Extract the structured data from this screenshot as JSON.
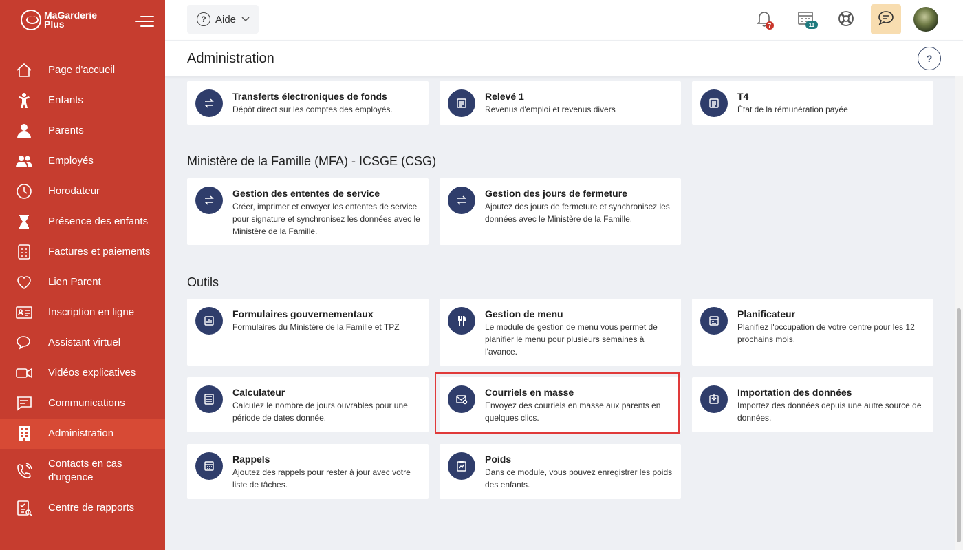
{
  "app": {
    "brand_line1": "MaGarderie",
    "brand_line2": "Plus"
  },
  "sidebar": {
    "items": [
      {
        "label": "Page d'accueil",
        "icon": "home-icon"
      },
      {
        "label": "Enfants",
        "icon": "child-icon"
      },
      {
        "label": "Parents",
        "icon": "parent-icon"
      },
      {
        "label": "Employés",
        "icon": "employees-icon"
      },
      {
        "label": "Horodateur",
        "icon": "clock-icon"
      },
      {
        "label": "Présence des enfants",
        "icon": "hourglass-icon"
      },
      {
        "label": "Factures et paiements",
        "icon": "invoice-icon"
      },
      {
        "label": "Lien Parent",
        "icon": "heart-icon"
      },
      {
        "label": "Inscription en ligne",
        "icon": "id-card-icon"
      },
      {
        "label": "Assistant virtuel",
        "icon": "chat-bubbles-icon"
      },
      {
        "label": "Vidéos explicatives",
        "icon": "video-icon"
      },
      {
        "label": "Communications",
        "icon": "message-icon"
      },
      {
        "label": "Administration",
        "icon": "building-icon",
        "active": true
      },
      {
        "label": "Contacts en cas d'urgence",
        "icon": "phone-icon"
      },
      {
        "label": "Centre de rapports",
        "icon": "report-icon"
      }
    ]
  },
  "topbar": {
    "help_label": "Aide",
    "notification_count": "7",
    "calendar_count": "11"
  },
  "header": {
    "title": "Administration"
  },
  "sections": {
    "payroll": {
      "cards": [
        {
          "title": "Transferts électroniques de fonds",
          "desc": "Dépôt direct sur les comptes des employés.",
          "icon": "transfer-icon"
        },
        {
          "title": "Relevé 1",
          "desc": "Revenus d'emploi et revenus divers",
          "icon": "document-icon"
        },
        {
          "title": "T4",
          "desc": "État de la rémunération payée",
          "icon": "document-icon"
        }
      ]
    },
    "ministry": {
      "title": "Ministère de la Famille (MFA) - ICSGE (CSG)",
      "cards": [
        {
          "title": "Gestion des ententes de service",
          "desc": "Créer, imprimer et envoyer les ententes de service pour signature et synchronisez les données avec le Ministère de la Famille.",
          "icon": "transfer-icon"
        },
        {
          "title": "Gestion des jours de fermeture",
          "desc": "Ajoutez des jours de fermeture et synchronisez les données avec le Ministère de la Famille.",
          "icon": "transfer-icon"
        }
      ]
    },
    "tools": {
      "title": "Outils",
      "cards": [
        {
          "title": "Formulaires gouvernementaux",
          "desc": "Formulaires du Ministère de la Famille et TPZ",
          "icon": "chart-form-icon"
        },
        {
          "title": "Gestion de menu",
          "desc": "Le module de gestion de menu vous permet de planifier le menu pour plusieurs semaines à l'avance.",
          "icon": "utensils-icon"
        },
        {
          "title": "Planificateur",
          "desc": "Planifiez l'occupation de votre centre pour les 12 prochains mois.",
          "icon": "planner-icon"
        },
        {
          "title": "Calculateur",
          "desc": "Calculez le nombre de jours ouvrables pour une période de dates donnée.",
          "icon": "calculator-icon"
        },
        {
          "title": "Courriels en masse",
          "desc": "Envoyez des courriels en masse aux parents en quelques clics.",
          "icon": "mass-email-icon"
        },
        {
          "title": "Importation des données",
          "desc": "Importez des données depuis une autre source de données.",
          "icon": "import-icon"
        },
        {
          "title": "Rappels",
          "desc": "Ajoutez des rappels pour rester à jour avec votre liste de tâches.",
          "icon": "reminder-icon"
        },
        {
          "title": "Poids",
          "desc": "Dans ce module, vous pouvez enregistrer les poids des enfants.",
          "icon": "weight-icon"
        }
      ]
    }
  },
  "colors": {
    "sidebar": "#c63d2f",
    "sidebar_active": "#d74a35",
    "icon_circle": "#2f3d6b",
    "highlight": "#e03a3a",
    "chat_button": "#f8ddb0"
  }
}
